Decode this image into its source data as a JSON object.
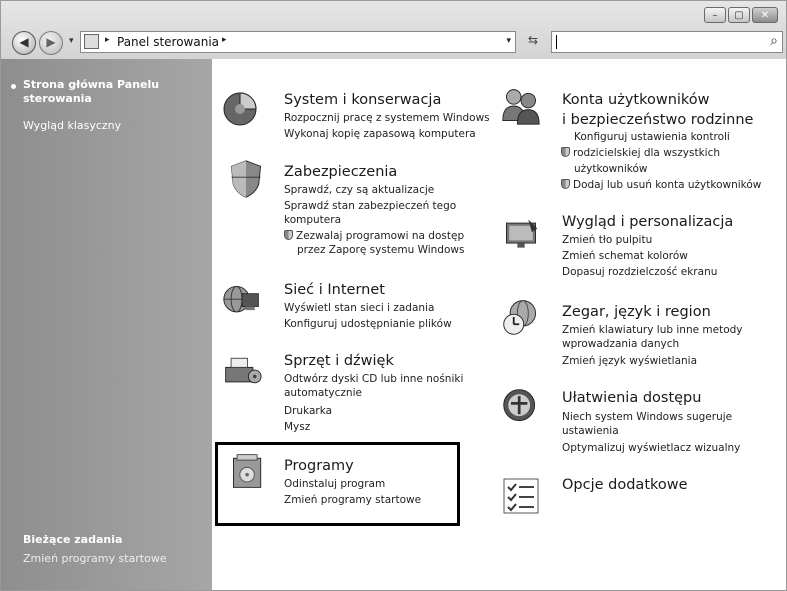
{
  "window": {
    "minimize_label": "–",
    "maximize_label": "▢",
    "close_label": "✕"
  },
  "nav": {
    "back_glyph": "◀",
    "forward_glyph": "▶",
    "dropdown_glyph": "▾",
    "address_separator": "▸",
    "address_text": "Panel sterowania",
    "refresh_glyph": "⇆",
    "search_icon": "⌕"
  },
  "sidebar": {
    "home_label": "Strona główna Panelu sterowania",
    "classic_label": "Wygląd klasyczny",
    "tasks_title": "Bieżące zadania",
    "task_item": "Zmień programy startowe"
  },
  "categories": {
    "system": {
      "title": "System i konserwacja",
      "links": [
        "Rozpocznij pracę z systemem Windows",
        "Wykonaj kopię zapasową komputera"
      ]
    },
    "security": {
      "title": "Zabezpieczenia",
      "links": [
        "Sprawdź, czy są aktualizacje",
        "Sprawdź stan zabezpieczeń tego",
        "komputera",
        "Zezwalaj programowi na dostęp",
        "przez Zaporę systemu Windows"
      ]
    },
    "network": {
      "title": "Sieć i Internet",
      "links": [
        "Wyświetl stan sieci i zadania",
        "Konfiguruj udostępnianie plików"
      ]
    },
    "hardware": {
      "title": "Sprzęt i dźwięk",
      "links": [
        "Odtwórz dyski CD lub inne nośniki",
        "automatycznie",
        "Drukarka",
        "Mysz"
      ]
    },
    "programs": {
      "title": "Programy",
      "links": [
        "Odinstaluj program",
        "Zmień programy startowe"
      ]
    },
    "users": {
      "title_line1": "Konta użytkowników",
      "title_line2": "i bezpieczeństwo rodzinne",
      "links": [
        "Konfiguruj ustawienia kontroli",
        "rodzicielskiej dla wszystkich",
        "użytkowników",
        "Dodaj lub usuń konta użytkowników"
      ]
    },
    "appearance": {
      "title": "Wygląd i personalizacja",
      "links": [
        "Zmień tło pulpitu",
        "Zmień schemat kolorów",
        "Dopasuj rozdzielczość ekranu"
      ]
    },
    "clock": {
      "title": "Zegar, język i region",
      "links": [
        "Zmień klawiatury lub inne metody",
        "wprowadzania danych",
        "Zmień język wyświetlania"
      ]
    },
    "ease": {
      "title": "Ułatwienia dostępu",
      "links": [
        "Niech system Windows sugeruje",
        "ustawienia",
        "Optymalizuj wyświetlacz wizualny"
      ]
    },
    "additional": {
      "title": "Opcje dodatkowe"
    }
  },
  "colors": {
    "sidebar": "#9a9a9a",
    "highlight_border": "#000000"
  }
}
